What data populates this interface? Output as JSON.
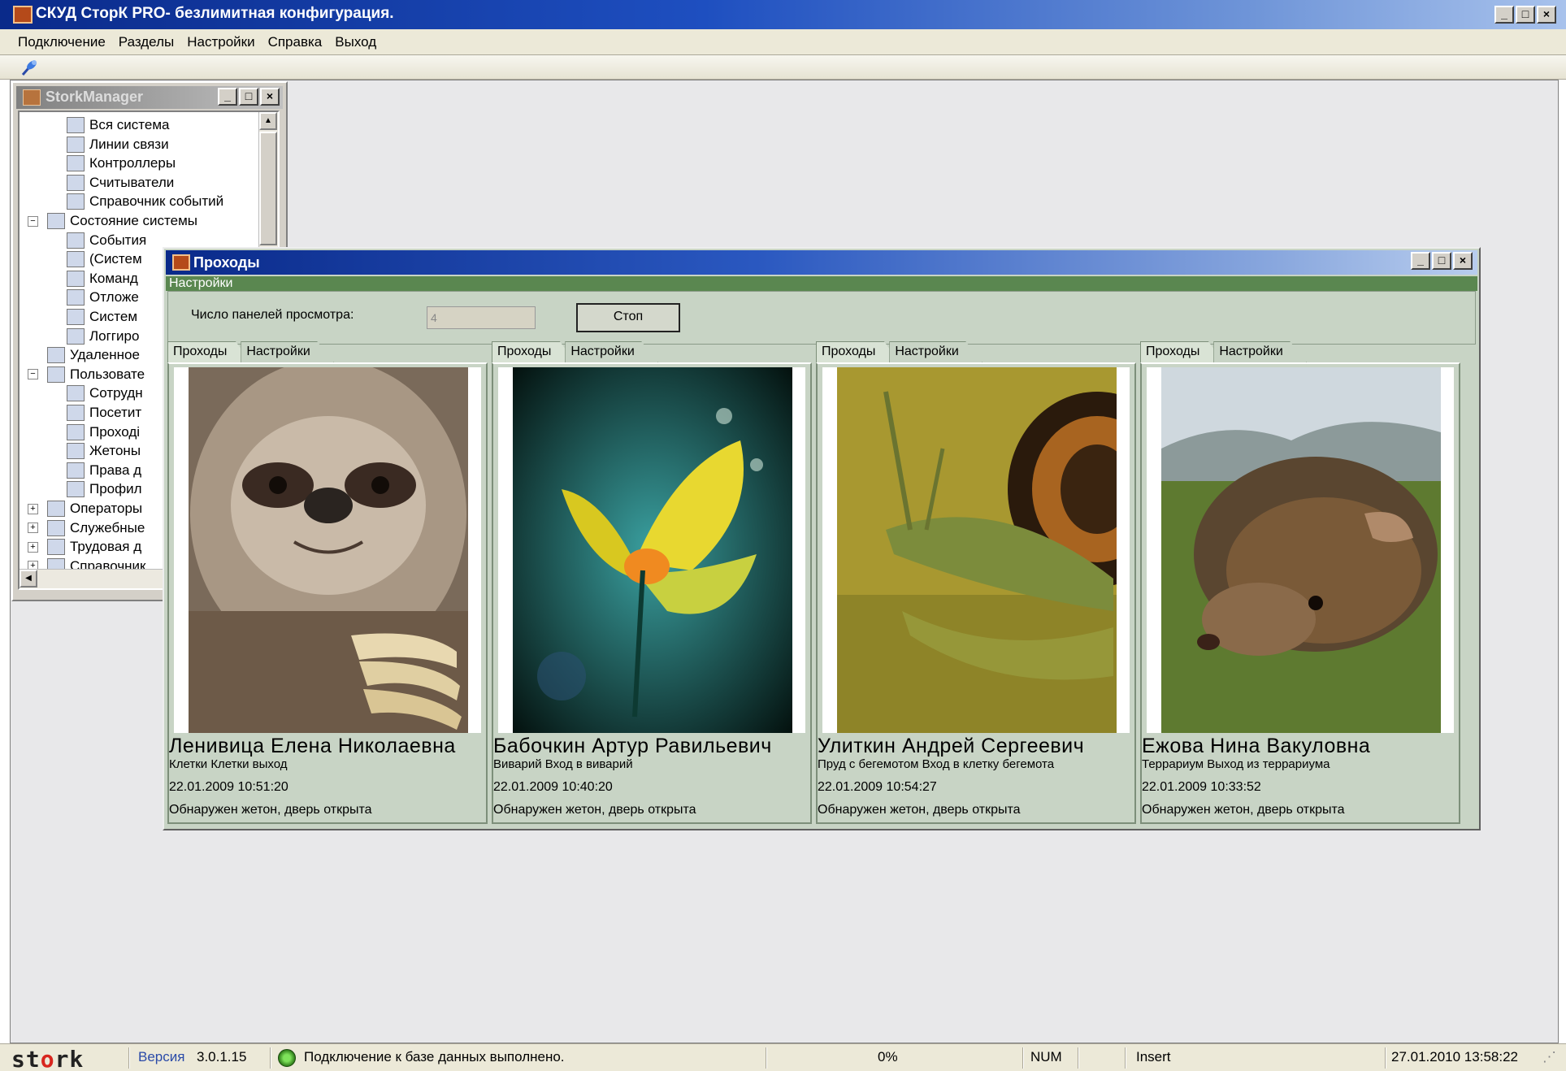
{
  "window": {
    "title": "СКУД СторК PRO- безлимитная конфигурация.",
    "controls": [
      "_",
      "□",
      "×"
    ]
  },
  "menu": [
    "Подключение",
    "Разделы",
    "Настройки",
    "Справка",
    "Выход"
  ],
  "manager": {
    "title": "StorkManager",
    "tree": [
      {
        "label": "Вся система",
        "level": 2
      },
      {
        "label": "Линии связи",
        "level": 2
      },
      {
        "label": "Контроллеры",
        "level": 2
      },
      {
        "label": "Считыватели",
        "level": 2
      },
      {
        "label": "Справочник событий",
        "level": 2
      },
      {
        "label": "Состояние системы",
        "level": 1,
        "expander": "−"
      },
      {
        "label": "События",
        "level": 2
      },
      {
        "label": "(Систем",
        "level": 2
      },
      {
        "label": "Команд",
        "level": 2
      },
      {
        "label": "Отложе",
        "level": 2
      },
      {
        "label": "Систем",
        "level": 2
      },
      {
        "label": "Логгиро",
        "level": 2
      },
      {
        "label": "Удаленное",
        "level": 1
      },
      {
        "label": "Пользовате",
        "level": 1,
        "expander": "−"
      },
      {
        "label": "Сотрудн",
        "level": 2
      },
      {
        "label": "Посетит",
        "level": 2
      },
      {
        "label": "Проході",
        "level": 2
      },
      {
        "label": "Жетоны",
        "level": 2
      },
      {
        "label": "Права д",
        "level": 2
      },
      {
        "label": "Профил",
        "level": 2
      },
      {
        "label": "Операторы",
        "level": 1,
        "expander": "+"
      },
      {
        "label": "Служебные",
        "level": 1,
        "expander": "+"
      },
      {
        "label": "Трудовая д",
        "level": 1,
        "expander": "+"
      },
      {
        "label": "Справочник",
        "level": 1,
        "expander": "+"
      }
    ]
  },
  "passages": {
    "title": "Проходы",
    "settings_band": "Настройки",
    "panels_label": "Число панелей просмотра:",
    "panels_value": "4",
    "stop_label": "Стоп",
    "tab_passages": "Проходы",
    "tab_settings": "Настройки",
    "viewers": [
      {
        "name": "Ленивица Елена  Николаевна",
        "location": "Клетки Клетки выход",
        "time": "22.01.2009 10:51:20",
        "event": "Обнаружен жетон, дверь открыта",
        "photo": "sloth"
      },
      {
        "name": "Бабочкин Артур Равильевич",
        "location": "Виварий Вход в виварий",
        "time": "22.01.2009 10:40:20",
        "event": "Обнаружен жетон, дверь открыта",
        "photo": "butterfly"
      },
      {
        "name": "Улиткин Андрей Сергеевич",
        "location": "Пруд с бегемотом Вход в клетку бегемота",
        "time": "22.01.2009 10:54:27",
        "event": "Обнаружен жетон, дверь открыта",
        "photo": "snail"
      },
      {
        "name": "Ежова Нина Вакуловна",
        "location": "Террариум Выход из террариума",
        "time": "22.01.2009 10:33:52",
        "event": "Обнаружен жетон, дверь открыта",
        "photo": "hedgehog"
      }
    ]
  },
  "status": {
    "logo_left": "st",
    "logo_o": "o",
    "logo_right": "rk",
    "version_label": "Версия",
    "version": "3.0.1.15",
    "db_message": "Подключение к базе данных выполнено.",
    "progress": "0%",
    "num": "NUM",
    "insert": "Insert",
    "datetime": "27.01.2010 13:58:22"
  }
}
